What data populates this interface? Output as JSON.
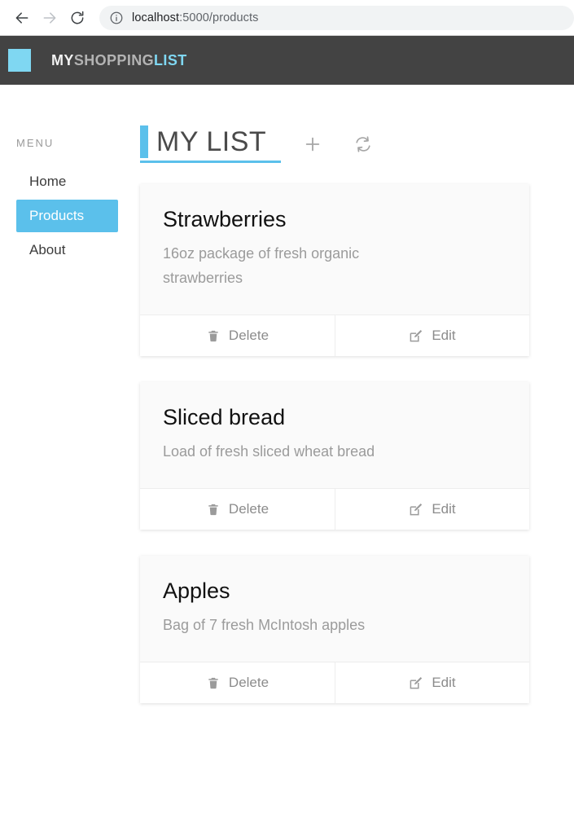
{
  "browser": {
    "back_icon": "back-arrow-icon",
    "forward_icon": "forward-arrow-icon",
    "reload_icon": "reload-icon",
    "info_icon": "info-circle-icon",
    "url_host": "localhost",
    "url_path": ":5000/products",
    "url_full": "localhost:5000/products"
  },
  "header": {
    "logo_icon": "logo-square-icon",
    "brand_part1": "MY",
    "brand_part2": "SHOPPING",
    "brand_part3": "LIST",
    "background_color": "#434343",
    "accent_color": "#7fd7f2"
  },
  "sidebar": {
    "label": "MENU",
    "items": [
      {
        "label": "Home",
        "active": false
      },
      {
        "label": "Products",
        "active": true
      },
      {
        "label": "About",
        "active": false
      }
    ],
    "active_color": "#5bc0eb"
  },
  "main": {
    "title": "MY LIST",
    "accent_color": "#5bc0eb",
    "actions": [
      {
        "name": "add-product-button",
        "icon": "plus-icon"
      },
      {
        "name": "refresh-list-button",
        "icon": "sync-refresh-icon"
      }
    ],
    "buttons": {
      "delete_label": "Delete",
      "delete_icon": "trash-icon",
      "edit_label": "Edit",
      "edit_icon": "pencil-square-icon"
    },
    "products": [
      {
        "name": "Strawberries",
        "description": "16oz package of fresh organic strawberries"
      },
      {
        "name": "Sliced bread",
        "description": "Load of fresh sliced wheat bread"
      },
      {
        "name": "Apples",
        "description": "Bag of 7 fresh McIntosh apples"
      }
    ]
  }
}
